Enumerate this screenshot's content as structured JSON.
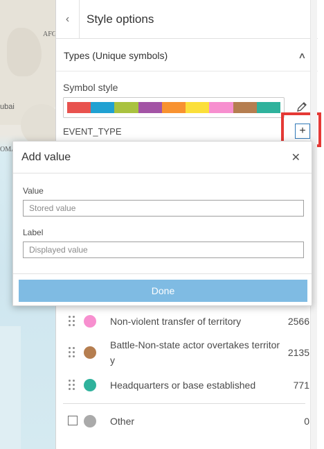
{
  "map": {
    "labels": [
      "AFG",
      "ubai",
      "OMA"
    ]
  },
  "header": {
    "back_icon": "chevron-left-icon",
    "title": "Style options"
  },
  "section": {
    "title": "Types (Unique symbols)",
    "toggle_icon": "chevron-up-icon"
  },
  "symbol_style": {
    "label": "Symbol style",
    "colors": [
      "#e8524e",
      "#20a1d2",
      "#a9c23f",
      "#a354a5",
      "#f89230",
      "#fbdf3a",
      "#f78fcf",
      "#b57e50",
      "#2fb29c"
    ],
    "edit_icon": "pencil-icon"
  },
  "field": {
    "name": "EVENT_TYPE",
    "add_icon": "plus-icon"
  },
  "modal": {
    "title": "Add value",
    "close_icon": "close-icon",
    "value_label": "Value",
    "value_placeholder": "Stored value",
    "value_current": "",
    "label_label": "Label",
    "label_placeholder": "Displayed value",
    "label_current": "",
    "done_label": "Done"
  },
  "list": {
    "items": [
      {
        "label": "Non-violent transfer of territory",
        "count": "2566",
        "color": "#f78fcf"
      },
      {
        "label": "Battle-Non-state actor overtakes territory",
        "count": "2135",
        "color": "#b57e50"
      },
      {
        "label": "Headquarters or base established",
        "count": "771",
        "color": "#2fb29c"
      }
    ],
    "other": {
      "label": "Other",
      "count": "0",
      "color": "#aaaaaa"
    }
  }
}
